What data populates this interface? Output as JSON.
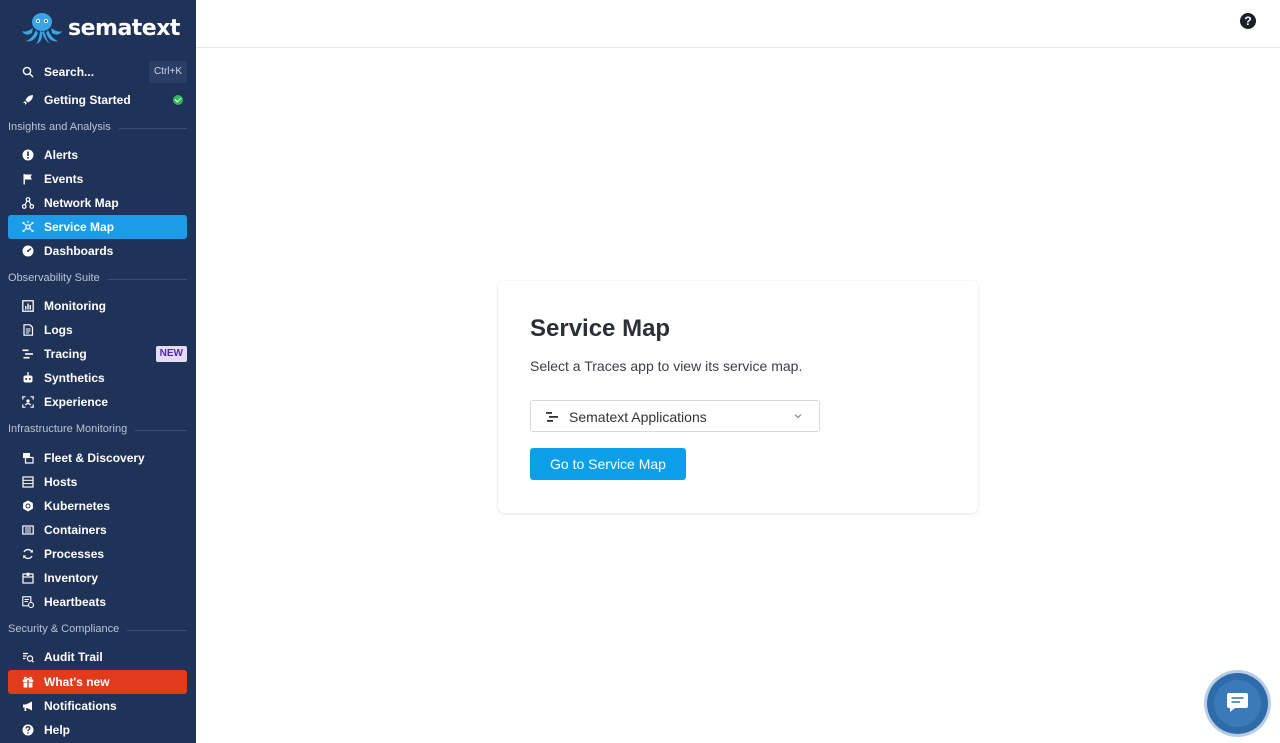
{
  "brand": {
    "name": "sematext"
  },
  "sidebar": {
    "search": {
      "label": "Search...",
      "shortcut": "Ctrl+K"
    },
    "getting_started": "Getting Started",
    "sections": {
      "insights": "Insights and Analysis",
      "observability": "Observability Suite",
      "infrastructure": "Infrastructure Monitoring",
      "security": "Security & Compliance"
    },
    "items": {
      "alerts": "Alerts",
      "events": "Events",
      "network_map": "Network Map",
      "service_map": "Service Map",
      "dashboards": "Dashboards",
      "monitoring": "Monitoring",
      "logs": "Logs",
      "tracing": "Tracing",
      "tracing_badge": "NEW",
      "synthetics": "Synthetics",
      "experience": "Experience",
      "fleet": "Fleet & Discovery",
      "hosts": "Hosts",
      "kubernetes": "Kubernetes",
      "containers": "Containers",
      "processes": "Processes",
      "inventory": "Inventory",
      "heartbeats": "Heartbeats",
      "audit_trail": "Audit Trail",
      "whats_new": "What's new",
      "notifications": "Notifications",
      "help": "Help"
    },
    "active_item": "service_map"
  },
  "topbar": {
    "help_icon": "?"
  },
  "main": {
    "title": "Service Map",
    "subtitle": "Select a Traces app to view its service map.",
    "select": {
      "value": "Sematext Applications"
    },
    "button": "Go to Service Map"
  },
  "colors": {
    "sidebar_bg": "#1f3258",
    "active": "#1a9ce8",
    "whats_new": "#e23a1c",
    "primary": "#0b9fe8",
    "success": "#2fb55d"
  },
  "icons": [
    "octopus-logo",
    "search-icon",
    "rocket-icon",
    "alert-circle-icon",
    "flag-icon",
    "network-icon",
    "service-map-icon",
    "dashboard-icon",
    "chart-icon",
    "logs-icon",
    "tracing-icon",
    "robot-icon",
    "experience-icon",
    "fleet-icon",
    "hosts-icon",
    "kubernetes-icon",
    "containers-icon",
    "processes-icon",
    "inventory-icon",
    "heartbeat-icon",
    "audit-icon",
    "gift-icon",
    "megaphone-icon",
    "help-icon",
    "chat-icon"
  ]
}
